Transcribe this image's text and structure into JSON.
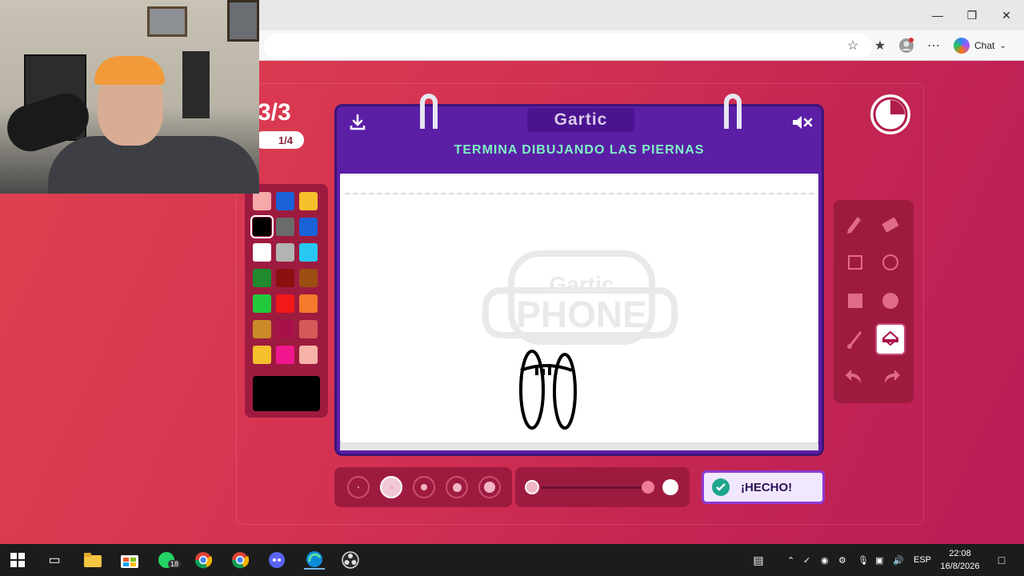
{
  "browser": {
    "chat_label": "Chat",
    "window_buttons": [
      "minimize",
      "restore",
      "close"
    ]
  },
  "game": {
    "round": "3/3",
    "sub_counter": "1/4",
    "logo_text": "Gartic",
    "instruction": "TERMINA DIBUJANDO LAS PIERNAS",
    "watermark_top": "Gartic",
    "watermark_bottom": "PHONE",
    "done_label": "¡HECHO!",
    "selected_color": "#000000",
    "palette": [
      [
        "#f5a9a9",
        "#1a62d8",
        "#f6c02c"
      ],
      [
        "#000000",
        "#6b6b6b",
        "#1a62d8"
      ],
      [
        "#ffffff",
        "#b3b3b3",
        "#29c8f2"
      ],
      [
        "#1f8a2e",
        "#8a0f0f",
        "#9c4d12"
      ],
      [
        "#22c93b",
        "#f01818",
        "#f47a2c"
      ],
      [
        "#c98a27",
        "#a8104a",
        "#d45a5a"
      ],
      [
        "#f6c02c",
        "#f0178f",
        "#f7b3a8"
      ]
    ],
    "tools": [
      "pencil-icon",
      "eraser-icon",
      "square-outline-icon",
      "circle-outline-icon",
      "square-filled-icon",
      "circle-filled-icon",
      "line-icon",
      "bucket-icon",
      "undo-icon",
      "redo-icon"
    ],
    "selected_tool": "bucket-icon",
    "brush_sizes": 5,
    "selected_brush_size": 2
  },
  "taskbar": {
    "whatsapp_badge": "18",
    "language": "ESP",
    "time": "22:08",
    "date": "16/8/2026"
  }
}
